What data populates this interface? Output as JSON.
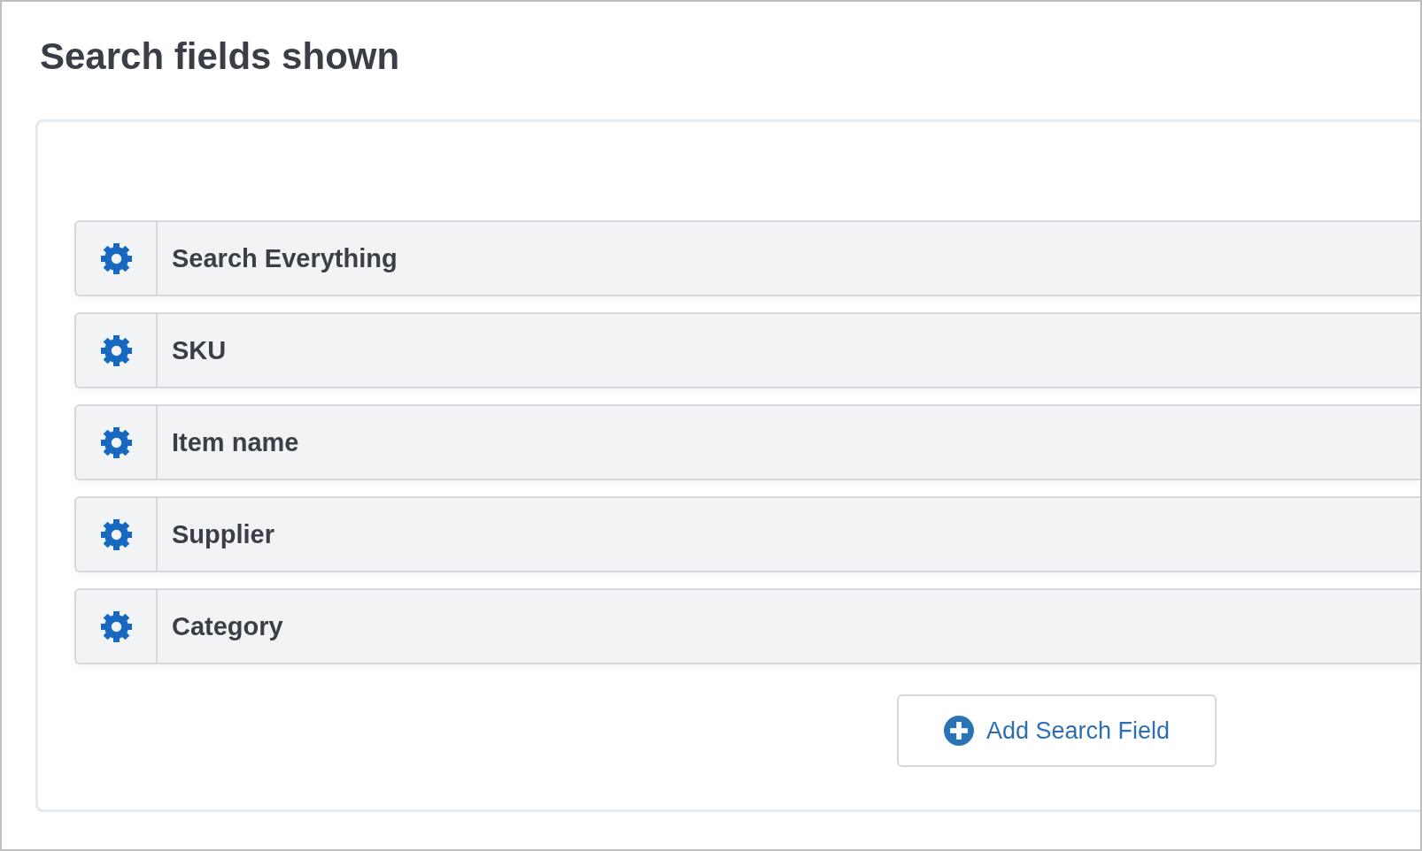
{
  "title": "Search fields shown",
  "search_fields": [
    {
      "label": "Search Everything"
    },
    {
      "label": "SKU"
    },
    {
      "label": "Item name"
    },
    {
      "label": "Supplier"
    },
    {
      "label": "Category"
    }
  ],
  "add_button": {
    "label": "Add Search Field"
  }
}
